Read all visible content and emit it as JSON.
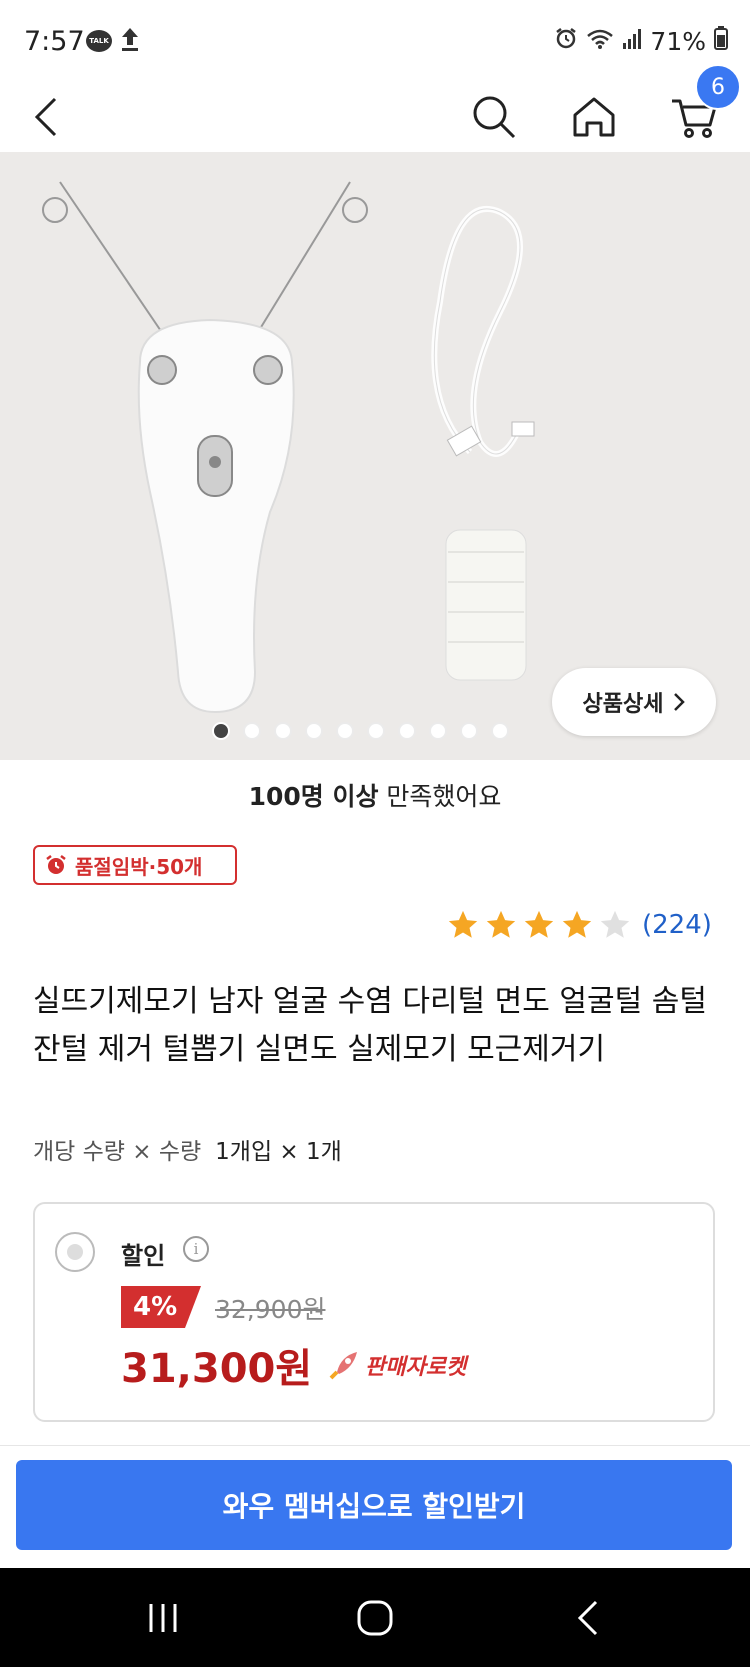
{
  "status": {
    "time": "7:57",
    "talk_icon_text": "TALK",
    "battery": "71%"
  },
  "nav": {
    "cart_count": "6"
  },
  "gallery": {
    "detail_label": "상품상세",
    "dot_count": 10,
    "active_index": 0
  },
  "satisfaction": {
    "bold": "100명 이상",
    "rest": " 만족했어요"
  },
  "soldout_badge": "품절임박·50개",
  "rating": {
    "stars": 4,
    "max": 5,
    "count": "(224)"
  },
  "product": {
    "title": "실뜨기제모기 남자 얼굴 수염 다리털 면도 얼굴털 솜털 잔털 제거 털뽑기 실면도 실제모기 모근제거기",
    "unit_label": "개당 수량 × 수량",
    "unit_value": "1개입 × 1개"
  },
  "price": {
    "discount_label": "할인",
    "percent": "4%",
    "original": "32,900원",
    "sale": "31,300원",
    "rocket_label": "판매자로켓"
  },
  "cta": {
    "wow_button": "와우 멤버십으로 할인받기"
  },
  "colors": {
    "accent_blue": "#3977f0",
    "sale_red": "#b71c1c",
    "star": "#f5a623"
  }
}
